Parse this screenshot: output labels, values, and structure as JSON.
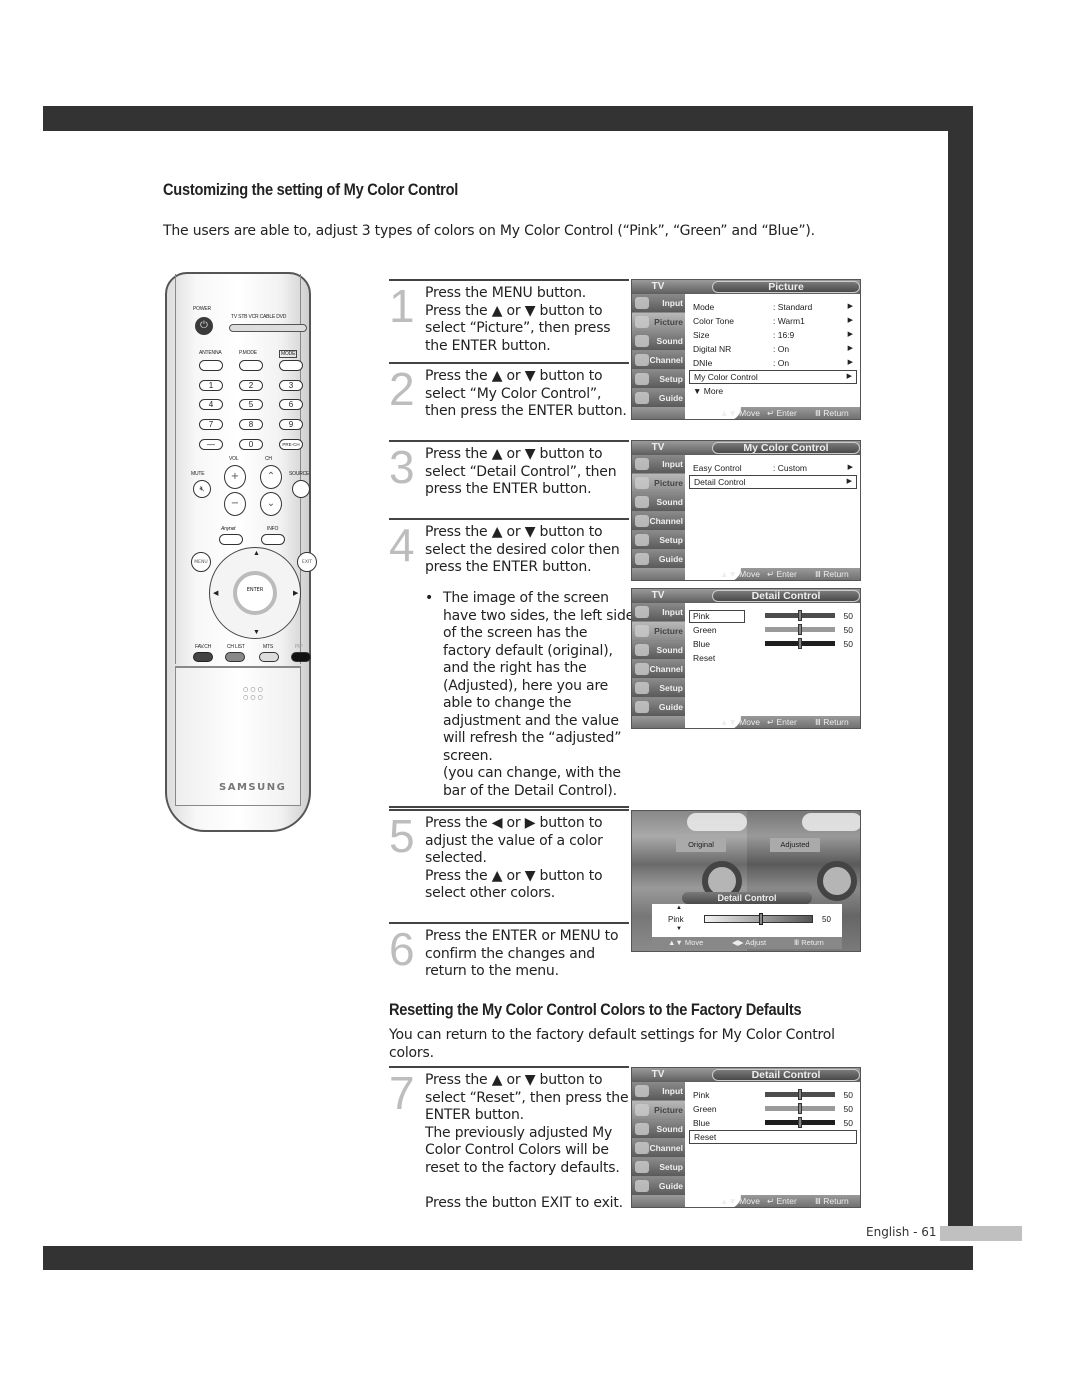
{
  "page": {
    "number_label": "English - 61"
  },
  "section1": {
    "title": "Customizing the setting of My Color Control",
    "intro": "The users are able to, adjust 3 types of colors on My Color Control (“Pink”, “Green” and “Blue”)."
  },
  "section2": {
    "title": "Resetting the My Color Control Colors to the Factory Defaults",
    "intro": "You can return to the factory default settings for My Color Control colors."
  },
  "steps": [
    {
      "num": "1",
      "text": "Press the MENU button.\nPress the ▲ or ▼ button to select “Picture”, then press the ENTER button."
    },
    {
      "num": "2",
      "text": "Press the ▲ or ▼ button to select “My Color Control”, then press the ENTER button."
    },
    {
      "num": "3",
      "text": "Press the ▲ or ▼ button to select “Detail Control”, then press the ENTER button."
    },
    {
      "num": "4",
      "text": "Press the ▲ or ▼ button to select the desired color then press the ENTER button."
    },
    {
      "num": "5",
      "text": "Press the ◀ or ▶ button to adjust the value of a color selected.\nPress the ▲ or ▼ button to select other colors."
    },
    {
      "num": "6",
      "text": "Press the ENTER or MENU to confirm the changes and return to the menu."
    },
    {
      "num": "7",
      "text": "Press the ▲ or ▼ button to select “Reset”, then press the ENTER button.\nThe previously adjusted My Color Control Colors will be reset to the factory defaults.\n\nPress the button EXIT to exit."
    }
  ],
  "bullet": {
    "dot": "•",
    "text": "The image of the screen have two sides, the left side of the screen has the factory default (original), and the right has the (Adjusted), here you are able to change the adjustment and the value will refresh the “adjusted” screen.\n(you can change, with the bar of the Detail Control)."
  },
  "osd_common": {
    "tv_label": "TV",
    "sidebar": [
      "Input",
      "Picture",
      "Sound",
      "Channel",
      "Setup",
      "Guide"
    ],
    "footer": {
      "move": "▲▼ Move",
      "enter": "↵ Enter",
      "return": "Ⅲ Return",
      "adjust": "◀▶ Adjust"
    }
  },
  "osd_picture": {
    "title": "Picture",
    "rows": [
      {
        "label": "Mode",
        "value": ": Standard",
        "arrow": "▶"
      },
      {
        "label": "Color Tone",
        "value": ": Warm1",
        "arrow": "▶"
      },
      {
        "label": "Size",
        "value": ": 16:9",
        "arrow": "▶"
      },
      {
        "label": "Digital NR",
        "value": ": On",
        "arrow": "▶"
      },
      {
        "label": "DNIe",
        "value": ": On",
        "arrow": "▶"
      },
      {
        "label": "My Color Control",
        "value": "",
        "arrow": "▶"
      },
      {
        "label": "▼ More",
        "value": "",
        "arrow": ""
      }
    ]
  },
  "osd_mycolor": {
    "title": "My Color Control",
    "rows": [
      {
        "label": "Easy Control",
        "value": ": Custom",
        "arrow": "▶"
      },
      {
        "label": "Detail Control",
        "value": "",
        "arrow": "▶"
      }
    ]
  },
  "osd_detail": {
    "title": "Detail Control",
    "colors": [
      {
        "label": "Pink",
        "value": "50",
        "level": 0.5,
        "color": "#4d4d4d"
      },
      {
        "label": "Green",
        "value": "50",
        "level": 0.5,
        "color": "#9a9a9a"
      },
      {
        "label": "Blue",
        "value": "50",
        "level": 0.5,
        "color": "#1e1e1e"
      }
    ],
    "reset_label": "Reset"
  },
  "osd_photo": {
    "original_label": "Original",
    "adjusted_label": "Adjusted",
    "title": "Detail Control",
    "selected_label": "Pink",
    "value": "50",
    "level": 0.5,
    "up": "▲",
    "down": "▼"
  },
  "remote": {
    "power": "POWER",
    "power_glyph": "⏻",
    "modes": "TV  STB  VCR  CABLE  DVD",
    "antenna": "ANTENNA",
    "pmode": "P.MODE",
    "mode": "MODE",
    "digits": [
      "1",
      "2",
      "3",
      "4",
      "5",
      "6",
      "7",
      "8",
      "9",
      "—",
      "0",
      "PRE-CH"
    ],
    "vol": "VOL",
    "ch": "CH",
    "mute": "MUTE",
    "source": "SOURCE",
    "anynet": "Anynet",
    "info": "INFO",
    "menu": "MENU",
    "exit": "EXIT",
    "enter": "ENTER",
    "fav_ch": "FAV.CH",
    "ch_list": "CH LIST",
    "mts": "MTS",
    "pip": "PIP",
    "brand": "SAMSUNG"
  }
}
